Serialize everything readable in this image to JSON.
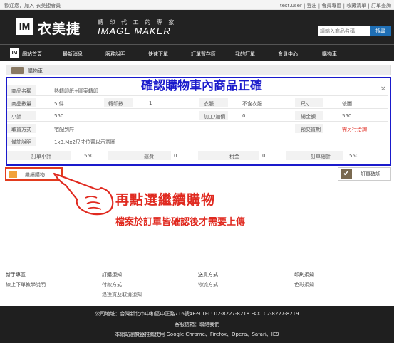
{
  "topbar": {
    "left_text": "歡迎您，加入 衣美捷會員",
    "right_text": "test.user  |  登出  |  會員專區  |  收藏清單  |  訂單查詢"
  },
  "header": {
    "logo_text": "IM",
    "brand_cn": "衣美捷",
    "tagline": "轉 印 代 工 的 專 家",
    "brand_en": "IMAGE MAKER",
    "search_placeholder": "請輸入商品名稱",
    "search_button": "搜尋"
  },
  "nav": {
    "items": [
      "網站首頁",
      "最新消息",
      "服務說明",
      "快速下單",
      "訂單暫存區",
      "我的訂單",
      "會員中心",
      "購物車"
    ]
  },
  "cart": {
    "title": "購物車"
  },
  "form": {
    "product_name_label": "商品名稱",
    "product_name_value": "熱轉印紙+圖案轉印",
    "qty_label": "商品數量",
    "qty_value": "5 件",
    "print_count_label": "轉印數",
    "print_count_value": "1",
    "clothes_label": "衣服",
    "clothes_value": "不含衣服",
    "size_label": "尺寸",
    "size_value": "依圖",
    "subtotal_label": "小計",
    "subtotal_value": "550",
    "processing_label": "加工/加價",
    "processing_value": "0",
    "total_label": "總金額",
    "total_value": "550",
    "pay_label": "取貨方式",
    "pay_value": "宅配到府",
    "days_label": "預交貨期",
    "days_value": "需另行洽詢",
    "note_label": "備註說明",
    "note_value": "1x3.Mx2尺寸位置以示意圖",
    "order_subtotal_label": "訂單小計",
    "order_subtotal_value": "550",
    "shipping_label": "運費",
    "shipping_value": "0",
    "tax_label": "稅金",
    "tax_value": "0",
    "order_total_label": "訂單總計",
    "order_total_value": "550"
  },
  "overlay_title": "確認購物車內商品正確",
  "buttons": {
    "continue_shopping": "繼續購物",
    "confirm_order": "訂單確認"
  },
  "annotations": {
    "line1": "再點選繼續購物",
    "line2": "檔案於訂單皆確認後才需要上傳"
  },
  "footer_links": {
    "col1": {
      "heading": "新手專區",
      "items": [
        "線上下單教學說明"
      ]
    },
    "col2": {
      "heading": "訂購須知",
      "items": [
        "付款方式",
        "退換貨及取消須知"
      ]
    },
    "col3": {
      "heading": "送貨方式",
      "items": [
        "物流方式"
      ]
    },
    "col4": {
      "heading": "印刷須知",
      "items": [
        "色彩須知"
      ]
    }
  },
  "footer": {
    "address_line": "公司地址：台灣新北市中和區中正路716號4F-9    TEL: 02-8227-8218    FAX: 02-8227-8219",
    "service_line": "客服信箱：聯絡我們",
    "browser_line": "本網站瀏覽器推薦使用 Google Chrome、Firefox、Opera、Safari、IE9"
  },
  "colors": {
    "header_bg": "#222222",
    "frame_blue": "#1a1acc",
    "annotation_red": "#e02a20",
    "search_button_bg": "#1f6fb5"
  }
}
